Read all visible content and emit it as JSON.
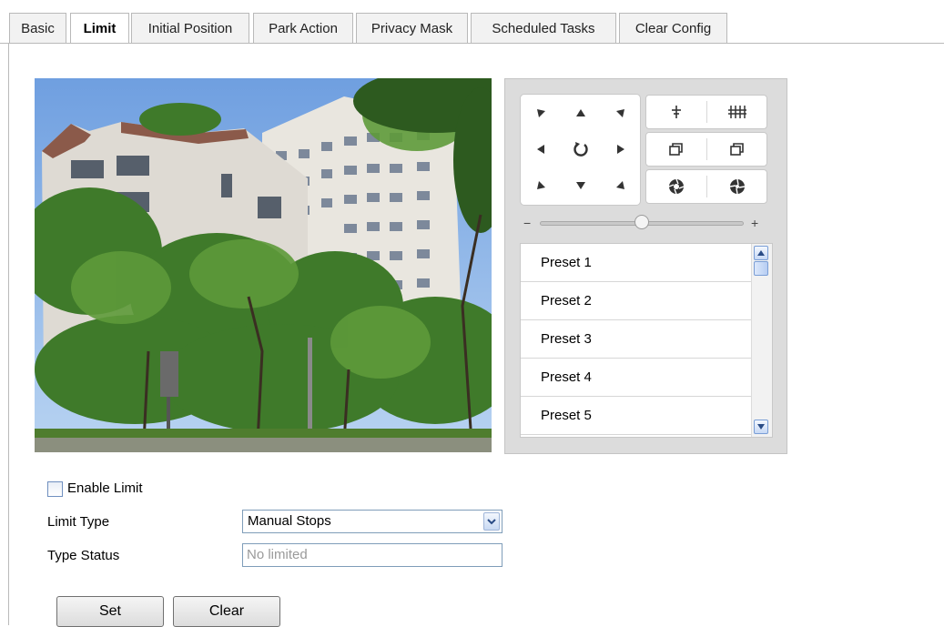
{
  "tabs": [
    {
      "label": "Basic"
    },
    {
      "label": "Limit"
    },
    {
      "label": "Initial Position"
    },
    {
      "label": "Park Action"
    },
    {
      "label": "Privacy Mask"
    },
    {
      "label": "Scheduled Tasks"
    },
    {
      "label": "Clear Config"
    }
  ],
  "active_tab": "Limit",
  "ptz": {
    "speed_minus": "−",
    "speed_plus": "+",
    "speed_level": 0.5,
    "presets": [
      {
        "label": "Preset 1"
      },
      {
        "label": "Preset 2"
      },
      {
        "label": "Preset 3"
      },
      {
        "label": "Preset 4"
      },
      {
        "label": "Preset 5"
      }
    ]
  },
  "form": {
    "enable_limit_label": "Enable Limit",
    "enable_limit_checked": false,
    "limit_type_label": "Limit Type",
    "limit_type_value": "Manual Stops",
    "type_status_label": "Type Status",
    "type_status_value": "No limited"
  },
  "buttons": {
    "set": "Set",
    "clear": "Clear"
  },
  "colors": {
    "panel_bg": "#dcdcdc",
    "scroll_accent": "#7a9ed6"
  }
}
